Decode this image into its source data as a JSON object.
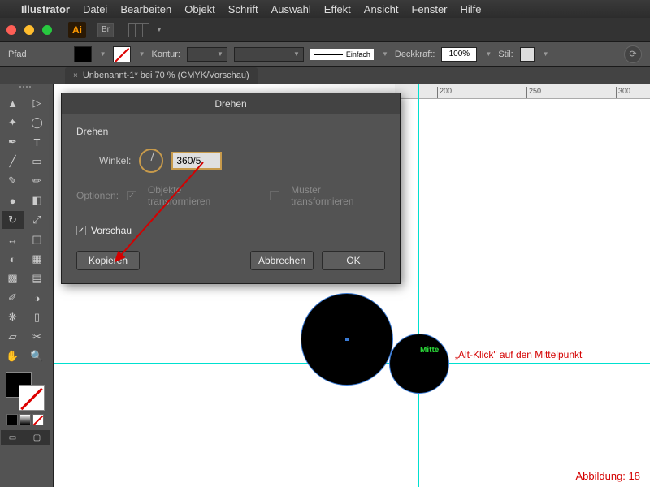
{
  "mac_menu": {
    "app": "Illustrator",
    "items": [
      "Datei",
      "Bearbeiten",
      "Objekt",
      "Schrift",
      "Auswahl",
      "Effekt",
      "Ansicht",
      "Fenster",
      "Hilfe"
    ]
  },
  "appbar": {
    "logo": "Ai",
    "br": "Br"
  },
  "control": {
    "selection": "Pfad",
    "stroke_label": "Kontur:",
    "stroke_weight": "",
    "stroke_style": "Einfach",
    "opacity_label": "Deckkraft:",
    "opacity_value": "100%",
    "style_label": "Stil:"
  },
  "doc_tab": "Unbenannt-1* bei 70 % (CMYK/Vorschau)",
  "ruler_ticks": [
    200,
    250,
    300
  ],
  "canvas": {
    "mitte_label": "Mitte",
    "alt_click": "„Alt-Klick\" auf den Mittelpunkt",
    "figure": "Abbildung: 18"
  },
  "dialog": {
    "title": "Drehen",
    "section": "Drehen",
    "angle_label": "Winkel:",
    "angle_value": "360/5",
    "options_label": "Optionen:",
    "opt_transform": "Objekte transformieren",
    "opt_pattern": "Muster transformieren",
    "preview": "Vorschau",
    "copy_btn": "Kopieren",
    "cancel_btn": "Abbrechen",
    "ok_btn": "OK"
  }
}
